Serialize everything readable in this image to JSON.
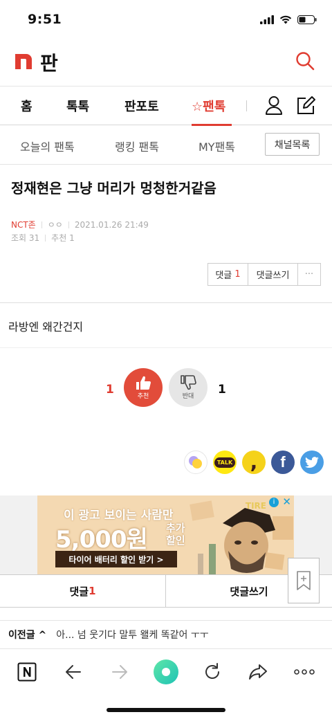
{
  "status_bar": {
    "time": "9:51"
  },
  "header": {
    "logo_letter": "n",
    "title": "판"
  },
  "main_nav": {
    "items": [
      {
        "label": "홈"
      },
      {
        "label": "톡톡"
      },
      {
        "label": "판포토"
      },
      {
        "label": "☆팬톡"
      }
    ]
  },
  "sub_nav": {
    "items": [
      {
        "label": "오늘의 팬톡"
      },
      {
        "label": "랭킹 팬톡"
      },
      {
        "label": "MY팬톡"
      }
    ],
    "channel_button": "채널목록"
  },
  "post": {
    "title": "정재현은 그냥 머리가 멍청한거같음",
    "author": "NCT존",
    "nickname": "ㅇㅇ",
    "datetime": "2021.01.26 21:49",
    "views_label": "조회 31",
    "recommend_label": "추천 1",
    "body": "라방엔 왜간건지"
  },
  "comment_tools": {
    "comments_label": "댓글",
    "comments_count": "1",
    "write_label": "댓글쓰기",
    "more_label": "···"
  },
  "votes": {
    "up_count": "1",
    "up_label": "추천",
    "down_count": "1",
    "down_label": "반대"
  },
  "share": {
    "buttons": [
      {
        "icon": "kakao-story-icon",
        "color": "#ffffff"
      },
      {
        "icon": "kakaotalk-icon",
        "label": "TALK",
        "color": "#ffe812"
      },
      {
        "icon": "kakao-comma-icon",
        "label": ",",
        "color": "#f5d21a"
      },
      {
        "icon": "facebook-icon",
        "label": "f",
        "color": "#3b5998"
      },
      {
        "icon": "twitter-icon",
        "color": "#4a9ee5"
      }
    ]
  },
  "ad": {
    "line1": "이 광고 보이는 사람만",
    "amount": "5,000원",
    "discount_line1": "추가",
    "discount_line2": "할인",
    "cta": "타이어 배터리 할인 받기 >",
    "brand": "TIRE",
    "info": "i",
    "close": "✕"
  },
  "bottom_bar": {
    "comments_label": "댓글",
    "comments_count": "1",
    "write_label": "댓글쓰기"
  },
  "prev_post": {
    "label": "이전글 ^",
    "title": "아... 넘 웃기다 말투 왤케 똑같어 ㅜㅜ"
  },
  "colors": {
    "brand_red": "#e03c31",
    "vote_up": "#e24c3a",
    "home_green": "#2ed18a"
  }
}
